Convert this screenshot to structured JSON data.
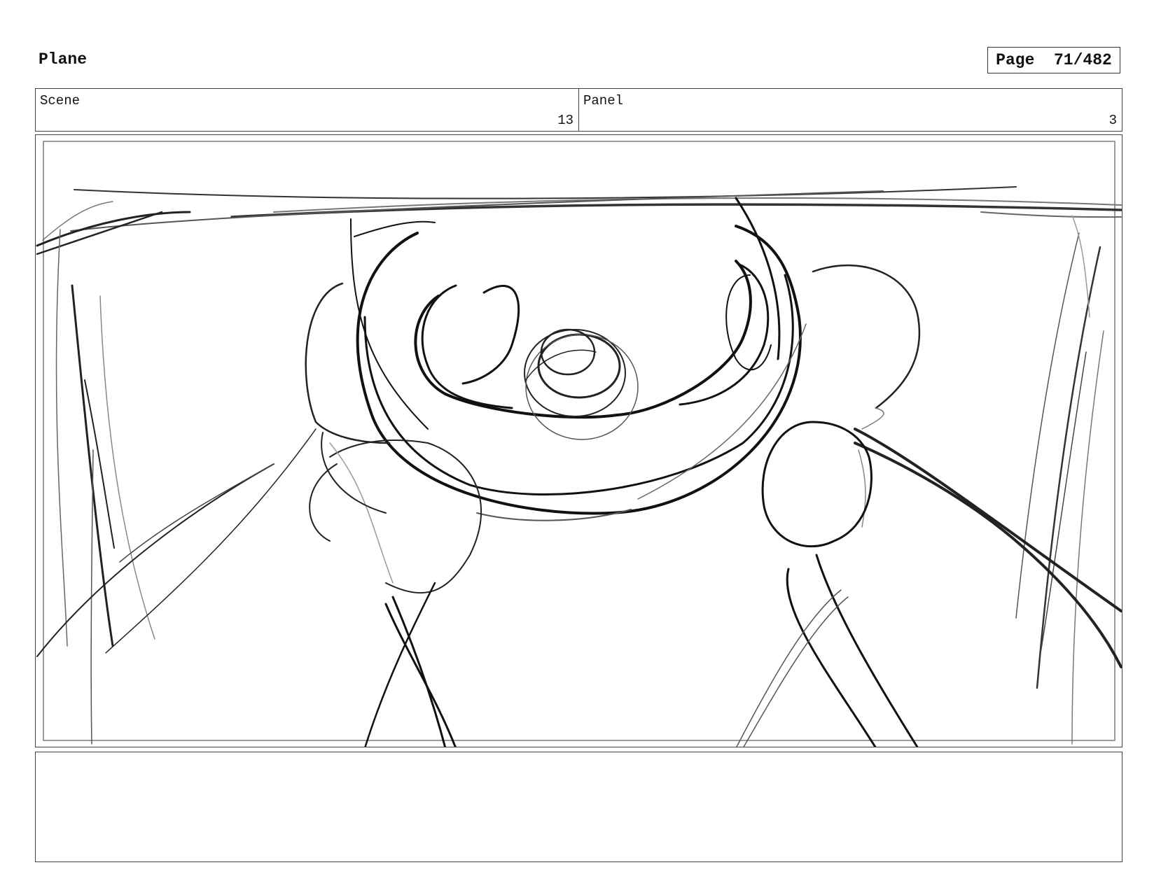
{
  "project": {
    "title": "Plane"
  },
  "page": {
    "label": "Page  71/482"
  },
  "scene": {
    "label": "Scene",
    "value": "13"
  },
  "panel": {
    "label": "Panel",
    "value": "3"
  },
  "notes": {
    "text": ""
  }
}
